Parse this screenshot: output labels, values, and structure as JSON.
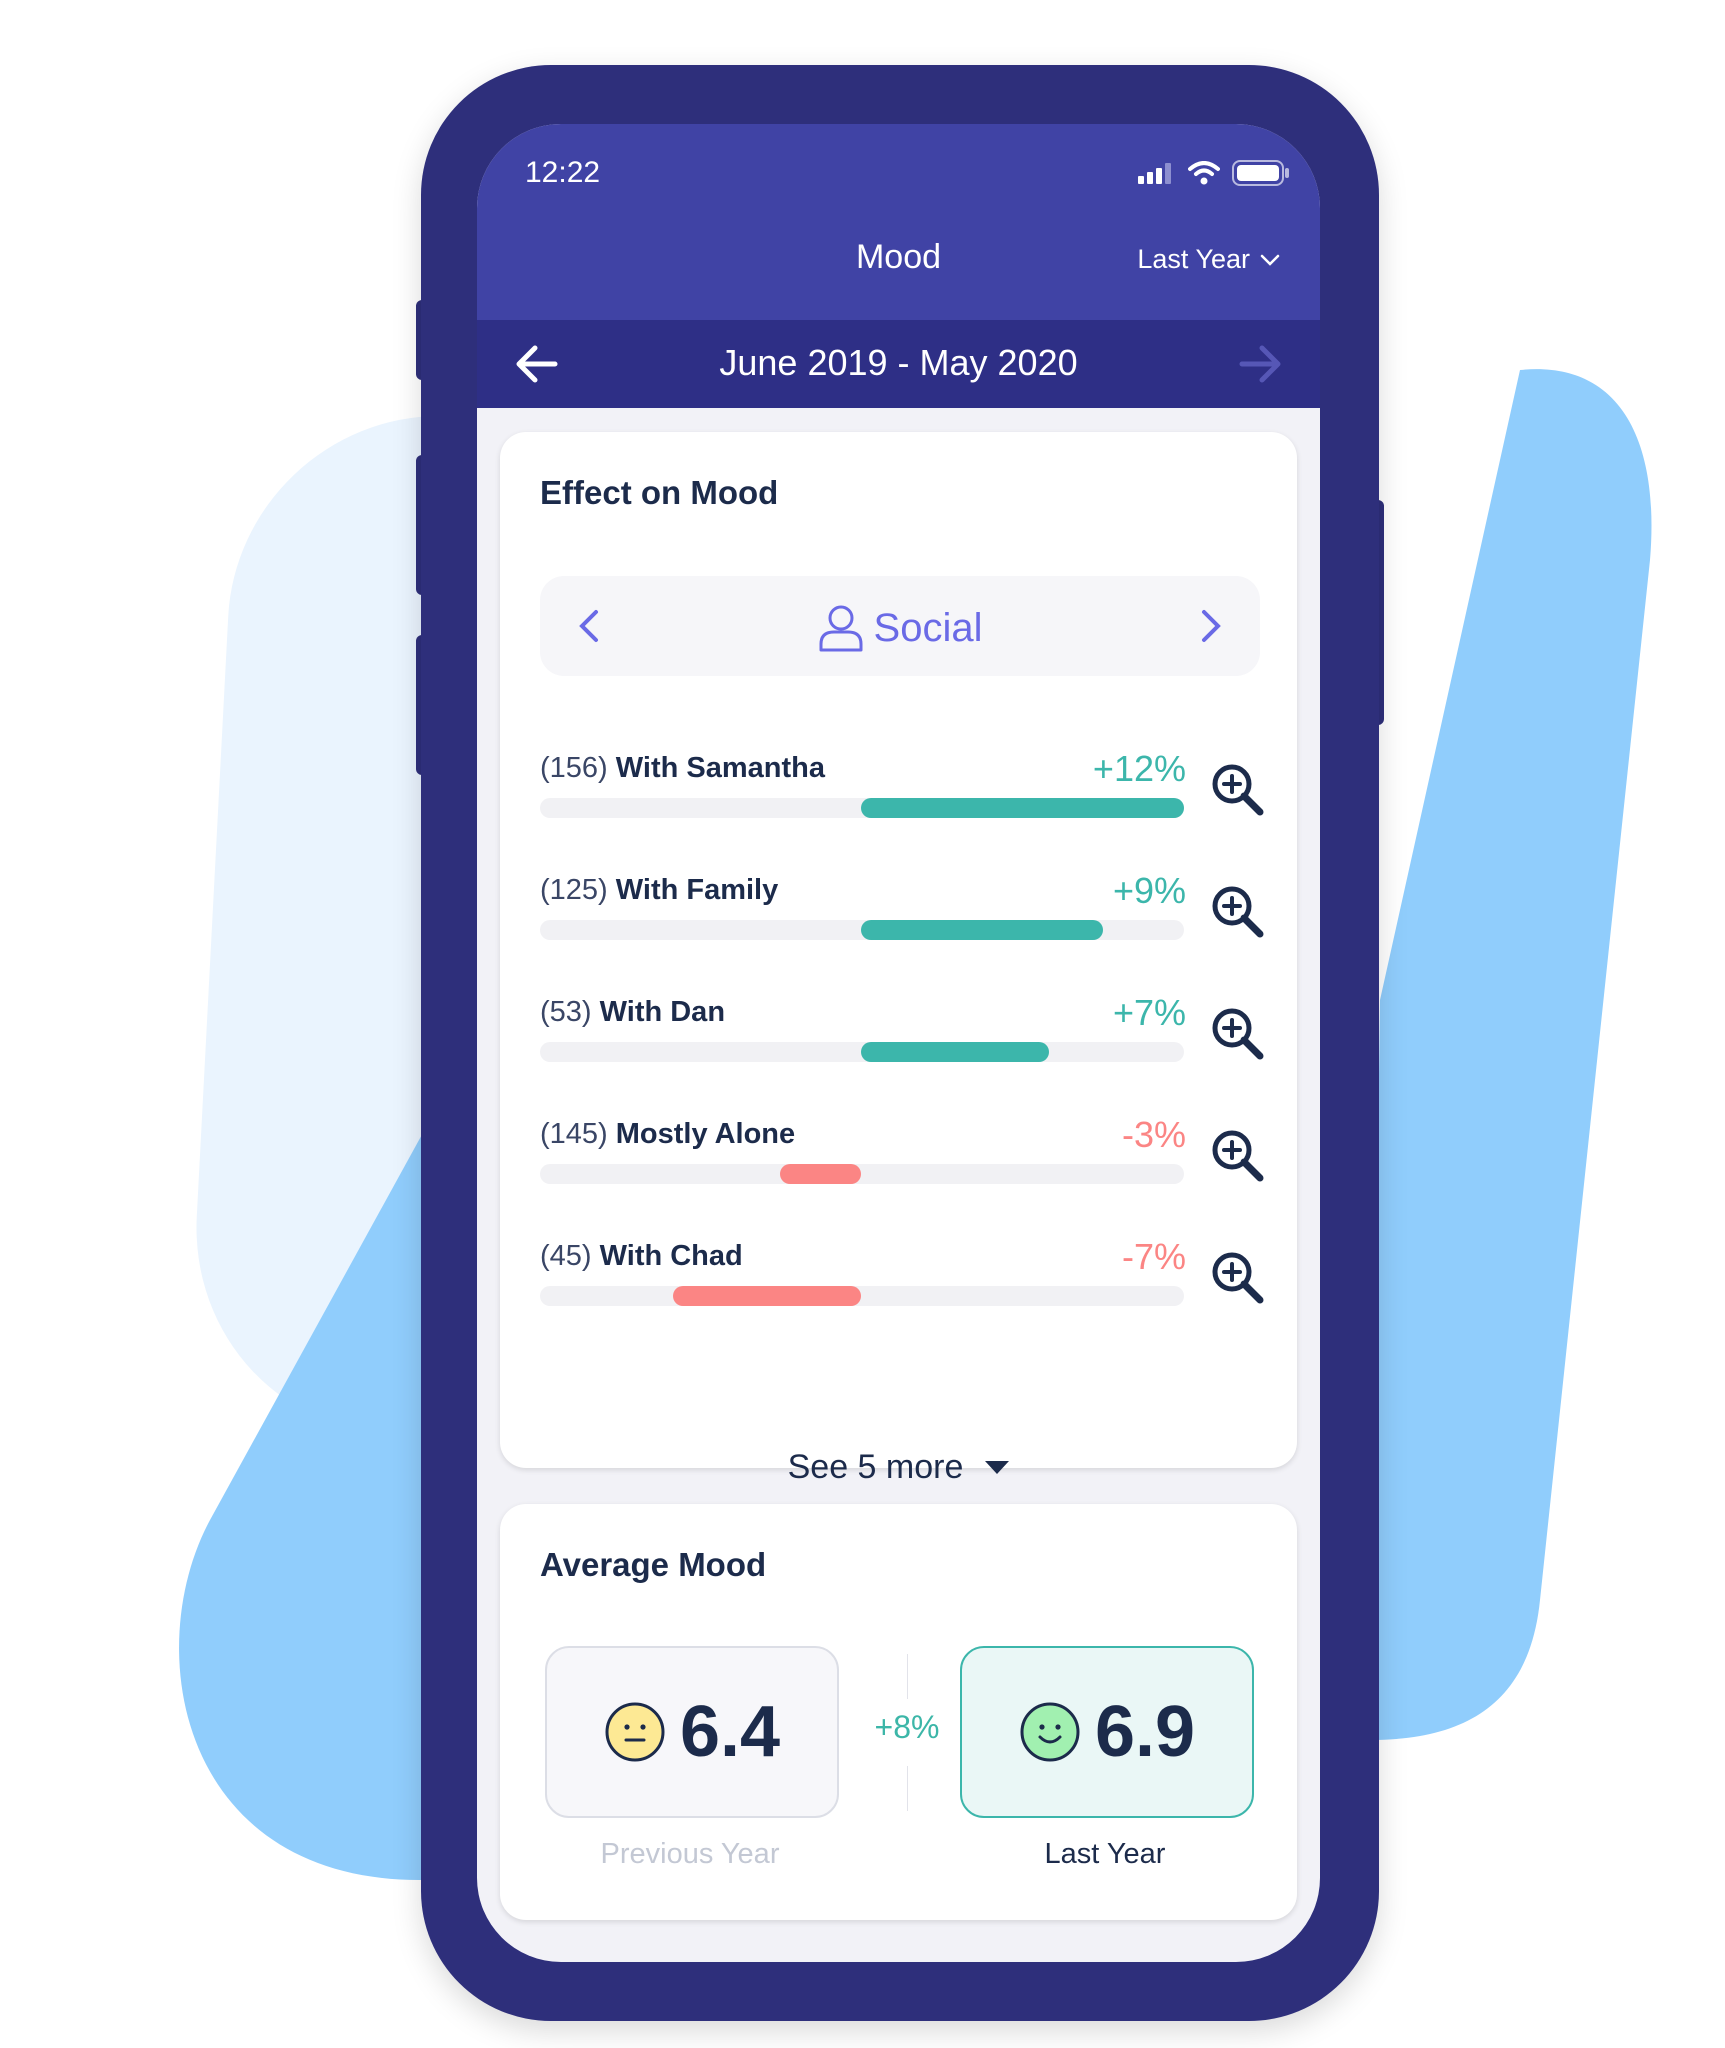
{
  "status_bar": {
    "time": "12:22"
  },
  "header": {
    "title": "Mood",
    "period_selector": "Last Year"
  },
  "date_nav": {
    "range": "June 2019 - May 2020",
    "prev_enabled": true,
    "next_enabled": false
  },
  "effect_card": {
    "title": "Effect on Mood",
    "category": {
      "label": "Social",
      "icon": "person-icon"
    },
    "rows": [
      {
        "count": "(156)",
        "name": "With Samantha",
        "percent_label": "+12%",
        "percent": 12
      },
      {
        "count": "(125)",
        "name": "With Family",
        "percent_label": "+9%",
        "percent": 9
      },
      {
        "count": "(53)",
        "name": "With Dan",
        "percent_label": "+7%",
        "percent": 7
      },
      {
        "count": "(145)",
        "name": "Mostly Alone",
        "percent_label": "-3%",
        "percent": -3
      },
      {
        "count": "(45)",
        "name": "With Chad",
        "percent_label": "-7%",
        "percent": -7
      }
    ],
    "max_percent": 12,
    "see_more": "See 5 more"
  },
  "average_card": {
    "title": "Average Mood",
    "previous": {
      "value": "6.4",
      "caption": "Previous Year",
      "face": "neutral-face-icon"
    },
    "current": {
      "value": "6.9",
      "caption": "Last Year",
      "face": "smile-face-icon"
    },
    "change": "+8%"
  },
  "colors": {
    "positive": "#3cb6ab",
    "negative": "#fb8584",
    "header": "#4043a5",
    "date_bar": "#2e2f86",
    "accent": "#6a6ae6",
    "text_dark": "#1c2b4b"
  }
}
